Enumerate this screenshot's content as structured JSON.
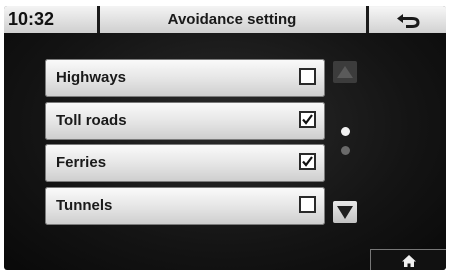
{
  "header": {
    "time": "10:32",
    "title": "Avoidance setting",
    "back_icon": "back-arrow-icon"
  },
  "avoid_list": {
    "items": [
      {
        "label": "Highways",
        "checked": false
      },
      {
        "label": "Toll roads",
        "checked": true
      },
      {
        "label": "Ferries",
        "checked": true
      },
      {
        "label": "Tunnels",
        "checked": false
      }
    ]
  },
  "scroll": {
    "up_icon": "triangle-up-icon",
    "down_icon": "triangle-down-icon",
    "page_count": 2,
    "current_page": 1,
    "up_enabled": false,
    "down_enabled": true
  },
  "footer": {
    "home_icon": "home-icon"
  },
  "colors": {
    "screen_bg": "#141414",
    "header_bg": "#dcdcdc",
    "row_bg": "#e4e4e4",
    "text": "#1a1a1a"
  }
}
